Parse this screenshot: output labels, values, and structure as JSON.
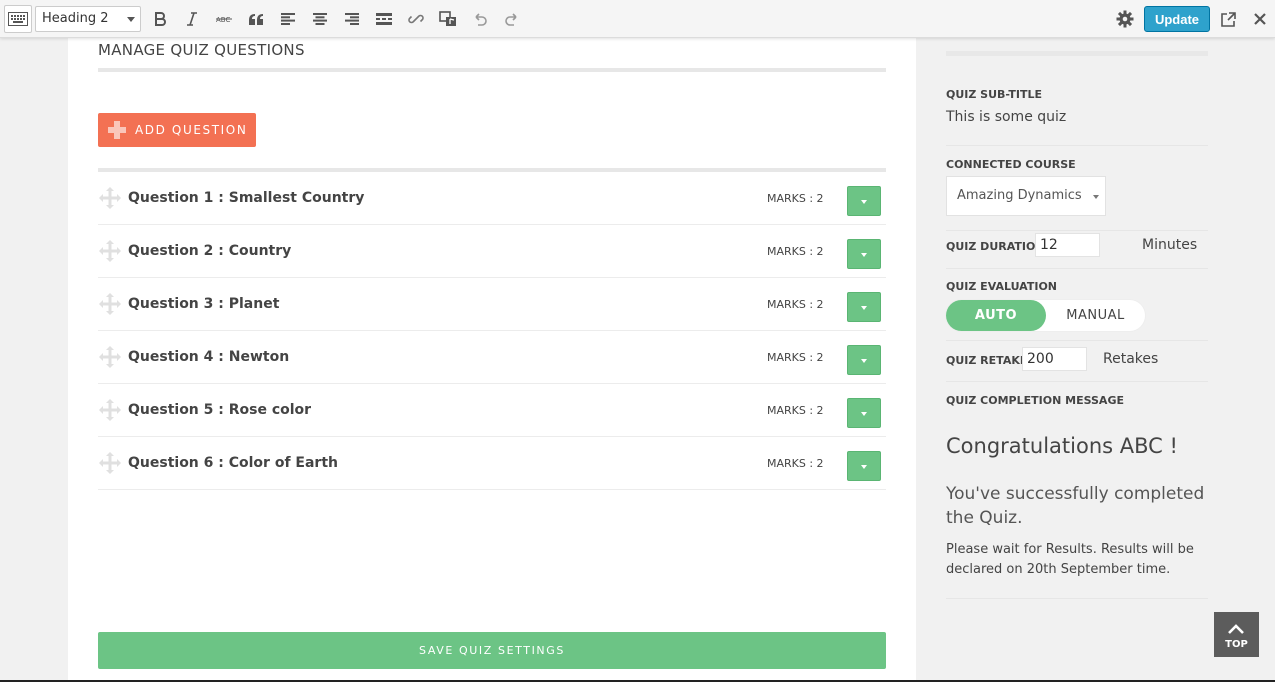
{
  "toolbar": {
    "format_value": "Heading 2",
    "update_label": "Update",
    "icons": [
      "keyboard-icon",
      "bold-icon",
      "italic-icon",
      "strikethrough-icon",
      "blockquote-icon",
      "align-left-icon",
      "align-center-icon",
      "align-right-icon",
      "read-more-icon",
      "link-icon",
      "media-icon",
      "undo-icon",
      "redo-icon",
      "gear-icon",
      "external-link-icon",
      "close-icon"
    ]
  },
  "main": {
    "section_title": "MANAGE QUIZ QUESTIONS",
    "add_question_label": "ADD QUESTION",
    "questions": [
      {
        "title": "Question 1 : Smallest Country",
        "marks": "MARKS : 2"
      },
      {
        "title": "Question 2 : Country",
        "marks": "MARKS : 2"
      },
      {
        "title": "Question 3 : Planet",
        "marks": "MARKS : 2"
      },
      {
        "title": "Question 4 : Newton",
        "marks": "MARKS : 2"
      },
      {
        "title": "Question 5 : Rose color",
        "marks": "MARKS : 2"
      },
      {
        "title": "Question 6 : Color of Earth",
        "marks": "MARKS : 2"
      }
    ],
    "save_label": "SAVE QUIZ SETTINGS"
  },
  "sidebar": {
    "subtitle_label": "QUIZ SUB-TITLE",
    "subtitle_value": "This is some quiz",
    "course_label": "CONNECTED COURSE",
    "course_value": "Amazing Dynamics",
    "duration_label": "QUIZ DURATION",
    "duration_value": "12",
    "duration_unit": "Minutes",
    "evaluation_label": "QUIZ EVALUATION",
    "evaluation_auto": "AUTO",
    "evaluation_manual": "MANUAL",
    "evaluation_selected": "AUTO",
    "retakes_label": "QUIZ RETAKES",
    "retakes_value": "200",
    "retakes_unit": "Retakes",
    "completion_label": "QUIZ COMPLETION MESSAGE",
    "completion_heading": "Congratulations ABC !",
    "completion_subheading": "You've successfully completed the Quiz.",
    "completion_text": "Please wait for Results. Results will be declared on 20th September time."
  },
  "top_button_label": "TOP",
  "colors": {
    "accent_green": "#6cc485",
    "accent_orange": "#f37153",
    "update_blue": "#2ea2cc"
  }
}
